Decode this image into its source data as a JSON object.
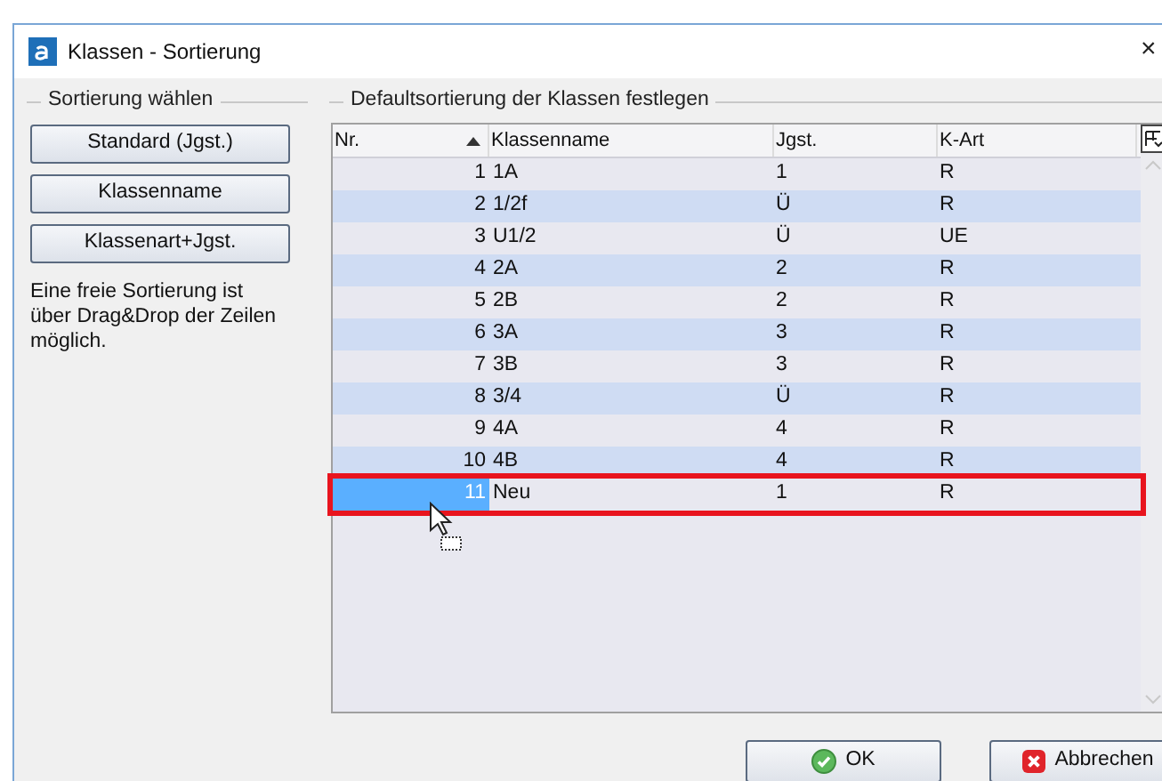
{
  "window": {
    "title": "Klassen - Sortierung",
    "close": "×"
  },
  "left_group": {
    "title": "Sortierung wählen",
    "buttons": [
      "Standard (Jgst.)",
      "Klassenname",
      "Klassenart+Jgst."
    ],
    "hint": "Eine freie Sortierung ist über Drag&Drop der Zeilen möglich."
  },
  "right_group": {
    "title": "Defaultsortierung der Klassen festlegen"
  },
  "table": {
    "columns": [
      {
        "label": "Nr.",
        "sorted": true
      },
      {
        "label": "Klassenname",
        "sorted": false
      },
      {
        "label": "Jgst.",
        "sorted": false
      },
      {
        "label": "K-Art",
        "sorted": false
      }
    ],
    "rows": [
      {
        "nr": "1",
        "name": "1A",
        "jgst": "1",
        "kart": "R",
        "selected": false
      },
      {
        "nr": "2",
        "name": "1/2f",
        "jgst": "Ü",
        "kart": "R",
        "selected": false
      },
      {
        "nr": "3",
        "name": "U1/2",
        "jgst": "Ü",
        "kart": "UE",
        "selected": false
      },
      {
        "nr": "4",
        "name": "2A",
        "jgst": "2",
        "kart": "R",
        "selected": false
      },
      {
        "nr": "5",
        "name": "2B",
        "jgst": "2",
        "kart": "R",
        "selected": false
      },
      {
        "nr": "6",
        "name": "3A",
        "jgst": "3",
        "kart": "R",
        "selected": false
      },
      {
        "nr": "7",
        "name": "3B",
        "jgst": "3",
        "kart": "R",
        "selected": false
      },
      {
        "nr": "8",
        "name": "3/4",
        "jgst": "Ü",
        "kart": "R",
        "selected": false
      },
      {
        "nr": "9",
        "name": "4A",
        "jgst": "4",
        "kart": "R",
        "selected": false
      },
      {
        "nr": "10",
        "name": "4B",
        "jgst": "4",
        "kart": "R",
        "selected": false
      },
      {
        "nr": "11",
        "name": "Neu",
        "jgst": "1",
        "kart": "R",
        "selected": true
      }
    ]
  },
  "buttons": [
    {
      "kind": "ok",
      "label": "OK"
    },
    {
      "kind": "cancel",
      "label": "Abbrechen"
    }
  ]
}
